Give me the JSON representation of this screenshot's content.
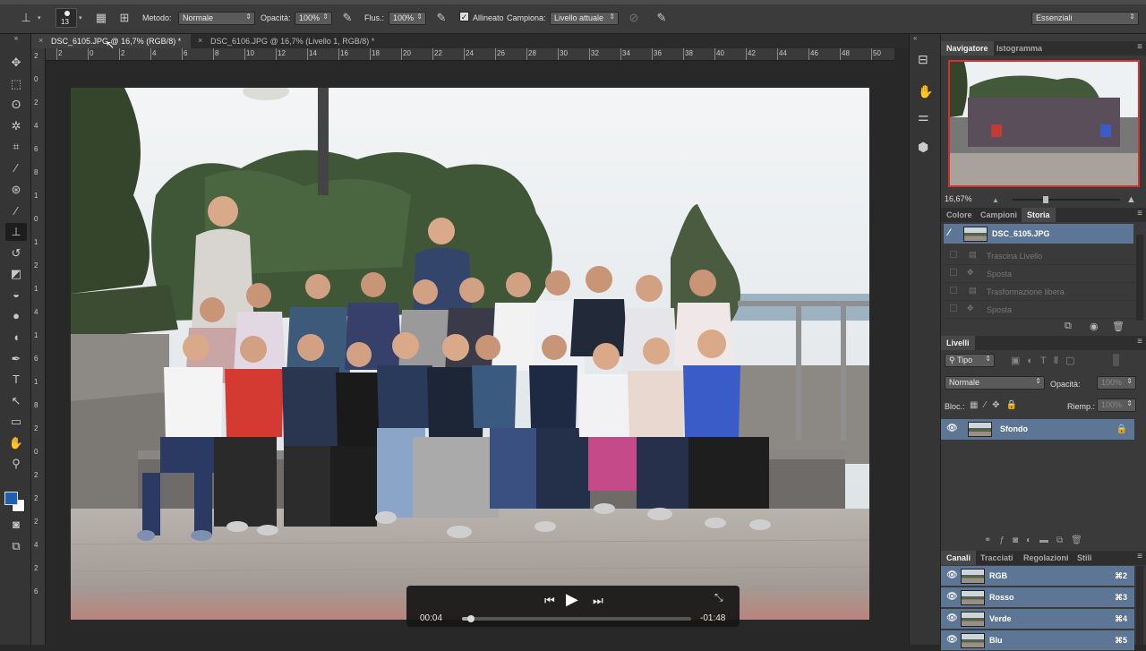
{
  "options_bar": {
    "brush_size": "13",
    "method_label": "Metodo:",
    "method_value": "Normale",
    "opacity_label": "Opacità:",
    "opacity_value": "100%",
    "flow_label": "Flus.:",
    "flow_value": "100%",
    "aligned_label": "Allineato",
    "sample_label": "Campiona:",
    "sample_value": "Livello attuale",
    "workspace_value": "Essenziali"
  },
  "tabs": [
    {
      "label": "DSC_6105.JPG @ 16,7% (RGB/8) *",
      "active": true
    },
    {
      "label": "DSC_6106.JPG @ 16,7% (Livello 1, RGB/8) *",
      "active": false
    }
  ],
  "ruler": {
    "h": [
      "2",
      "0",
      "2",
      "4",
      "6",
      "8",
      "10",
      "12",
      "14",
      "16",
      "18",
      "20",
      "22",
      "24",
      "26",
      "28",
      "30",
      "32",
      "34",
      "36",
      "38",
      "40",
      "42",
      "44",
      "46",
      "48",
      "50",
      "52"
    ],
    "v": [
      "2",
      "0",
      "2",
      "4",
      "6",
      "8",
      "1",
      "0",
      "1",
      "2",
      "1",
      "4",
      "1",
      "6",
      "1",
      "8",
      "2",
      "0",
      "2",
      "2",
      "2",
      "4",
      "2",
      "6"
    ]
  },
  "navigator": {
    "tabs": [
      "Navigatore",
      "Istogramma"
    ],
    "zoom": "16,67%"
  },
  "history": {
    "tabs": [
      "Colore",
      "Campioni",
      "Storia"
    ],
    "snapshot": "DSC_6105.JPG",
    "items": [
      "Trascina Livello",
      "Sposta",
      "Trasformazione libera",
      "Sposta"
    ]
  },
  "layers": {
    "title": "Livelli",
    "filter": "Tipo",
    "blend_mode": "Normale",
    "opacity_label": "Opacità:",
    "opacity_value": "100%",
    "lock_label": "Bloc.:",
    "fill_label": "Riemp.:",
    "fill_value": "100%",
    "layer_name": "Sfondo"
  },
  "channels": {
    "tabs": [
      "Canali",
      "Tracciati",
      "Regolazioni",
      "Stili"
    ],
    "rows": [
      {
        "name": "RGB",
        "key": "⌘2"
      },
      {
        "name": "Rosso",
        "key": "⌘3"
      },
      {
        "name": "Verde",
        "key": "⌘4"
      },
      {
        "name": "Blu",
        "key": "⌘5"
      }
    ]
  },
  "video": {
    "elapsed": "00:04",
    "remaining": "-01:48",
    "progress": 0.04
  },
  "colors": {
    "accent_selection": "#5e7695",
    "foreground_swatch": "#1f5fb0",
    "background_swatch": "#ffffff"
  }
}
